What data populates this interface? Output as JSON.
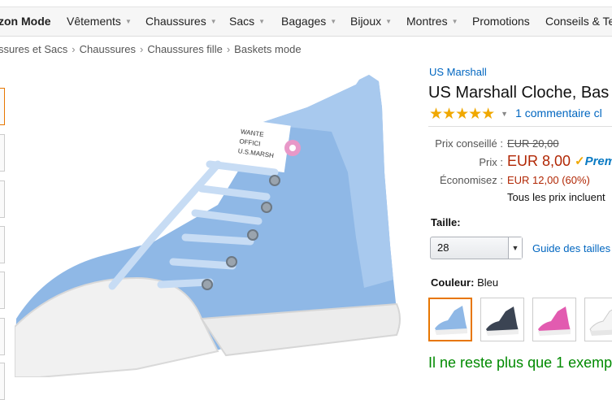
{
  "nav": {
    "brand": "zon Mode",
    "items": [
      "Vêtements",
      "Chaussures",
      "Sacs",
      "Bagages",
      "Bijoux",
      "Montres",
      "Promotions",
      "Conseils & Ten"
    ]
  },
  "breadcrumb": [
    "ssures et Sacs",
    "Chaussures",
    "Chaussures fille",
    "Baskets mode"
  ],
  "product": {
    "brand": "US Marshall",
    "title": "US Marshall Cloche, Bas",
    "stars": "★★★★★",
    "reviews_link": "1 commentaire cl",
    "rating": 5
  },
  "pricing": {
    "list_label": "Prix conseillé :",
    "list_price": "EUR 20,00",
    "price_label": "Prix :",
    "price": "EUR 8,00",
    "prime": "Prem",
    "savings_label": "Économisez :",
    "savings": "EUR 12,00 (60%)",
    "tax_note": "Tous les prix incluent"
  },
  "size": {
    "label": "Taille:",
    "selected": "28",
    "guide_link": "Guide des tailles"
  },
  "color": {
    "label": "Couleur:",
    "selected": "Bleu",
    "swatches": [
      "light-blue",
      "navy",
      "pink",
      "white"
    ]
  },
  "stock": {
    "message": "Il ne reste plus que 1 exemp"
  },
  "colors": {
    "link": "#0066c0",
    "price": "#b12704",
    "stock": "#008a00",
    "star": "#f0a800",
    "selected_border": "#e77600"
  }
}
